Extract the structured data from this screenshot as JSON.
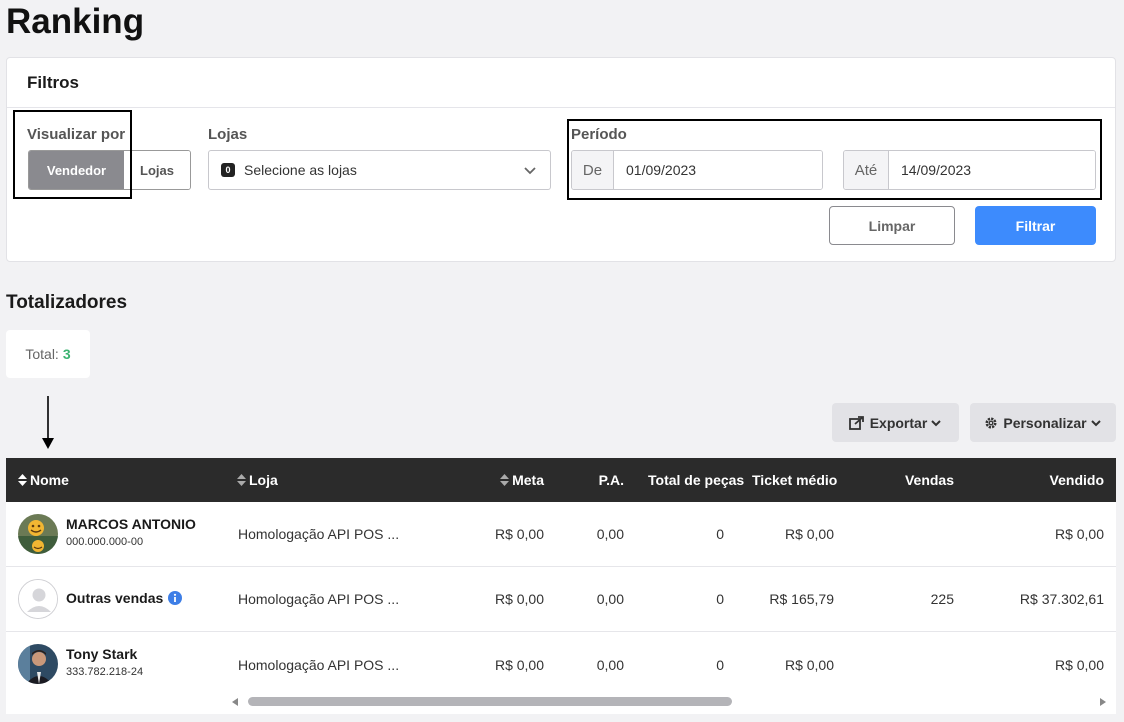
{
  "page": {
    "title": "Ranking"
  },
  "filters": {
    "title": "Filtros",
    "view_by": {
      "label": "Visualizar por",
      "options": [
        "Vendedor",
        "Lojas"
      ],
      "selected": "Vendedor"
    },
    "stores": {
      "label": "Lojas",
      "count": "0",
      "placeholder": "Selecione as lojas"
    },
    "period": {
      "label": "Período",
      "from_label": "De",
      "from_value": "01/09/2023",
      "to_label": "Até",
      "to_value": "14/09/2023"
    },
    "clear_label": "Limpar",
    "filter_label": "Filtrar"
  },
  "totals": {
    "title": "Totalizadores",
    "total_label": "Total:",
    "total_value": "3"
  },
  "toolbar": {
    "export_label": "Exportar",
    "customize_label": "Personalizar"
  },
  "table": {
    "columns": [
      "Nome",
      "Loja",
      "Meta",
      "P.A.",
      "Total de peças",
      "Ticket médio",
      "Vendas",
      "Vendido"
    ],
    "rows": [
      {
        "name": "MARCOS ANTONIO",
        "doc": "000.000.000-00",
        "store": "Homologação API POS ...",
        "meta": "R$ 0,00",
        "pa": "0,00",
        "pieces": "0",
        "ticket": "R$ 0,00",
        "sales": "",
        "sold": "R$ 0,00"
      },
      {
        "name": "Outras vendas",
        "doc": "",
        "store": "Homologação API POS ...",
        "meta": "R$ 0,00",
        "pa": "0,00",
        "pieces": "0",
        "ticket": "R$ 165,79",
        "sales": "225",
        "sold": "R$ 37.302,61"
      },
      {
        "name": "Tony Stark",
        "doc": "333.782.218-24",
        "store": "Homologação API POS ...",
        "meta": "R$ 0,00",
        "pa": "0,00",
        "pieces": "0",
        "ticket": "R$ 0,00",
        "sales": "",
        "sold": "R$ 0,00"
      }
    ]
  },
  "colors": {
    "primary": "#3d8bfd",
    "header_dark": "#2b2b2b",
    "total_green": "#3cb371",
    "segment_active": "#8a8a8f"
  }
}
